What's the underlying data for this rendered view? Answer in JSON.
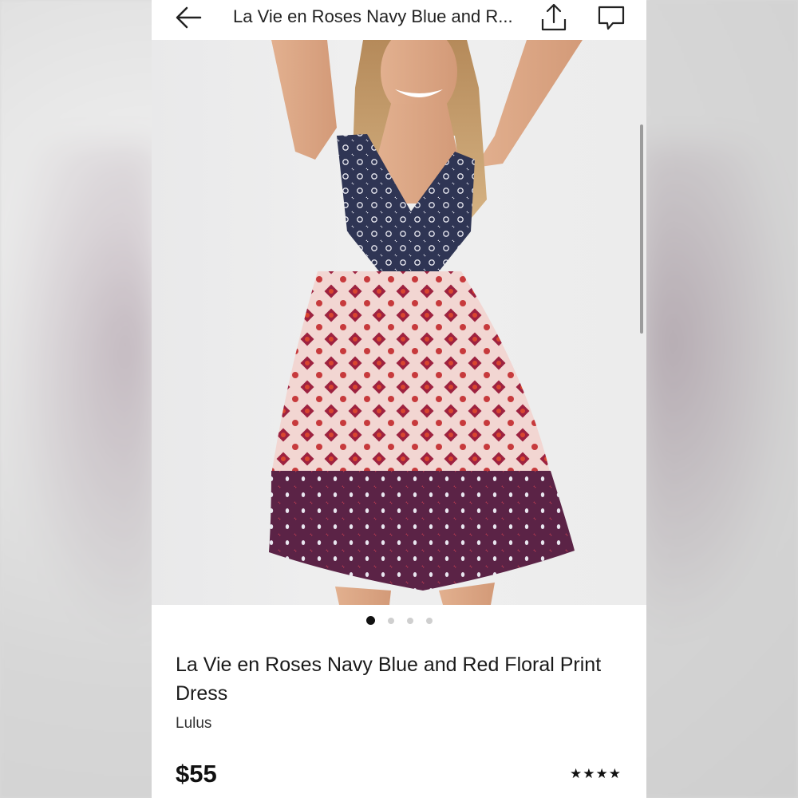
{
  "header": {
    "title": "La Vie en Roses Navy Blue and R..."
  },
  "icons": {
    "back": "back-arrow-icon",
    "share": "share-icon",
    "comment": "comment-icon"
  },
  "carousel": {
    "total": 4,
    "active_index": 0
  },
  "product": {
    "title": "La Vie en Roses Navy Blue and Red Floral Print Dress",
    "brand": "Lulus",
    "price": "$55",
    "rating_stars": "★★★★",
    "rating_value": 4
  },
  "colors": {
    "dress_navy": "#2f3554",
    "dress_red": "#b8334a",
    "dress_purple": "#5b2346"
  }
}
